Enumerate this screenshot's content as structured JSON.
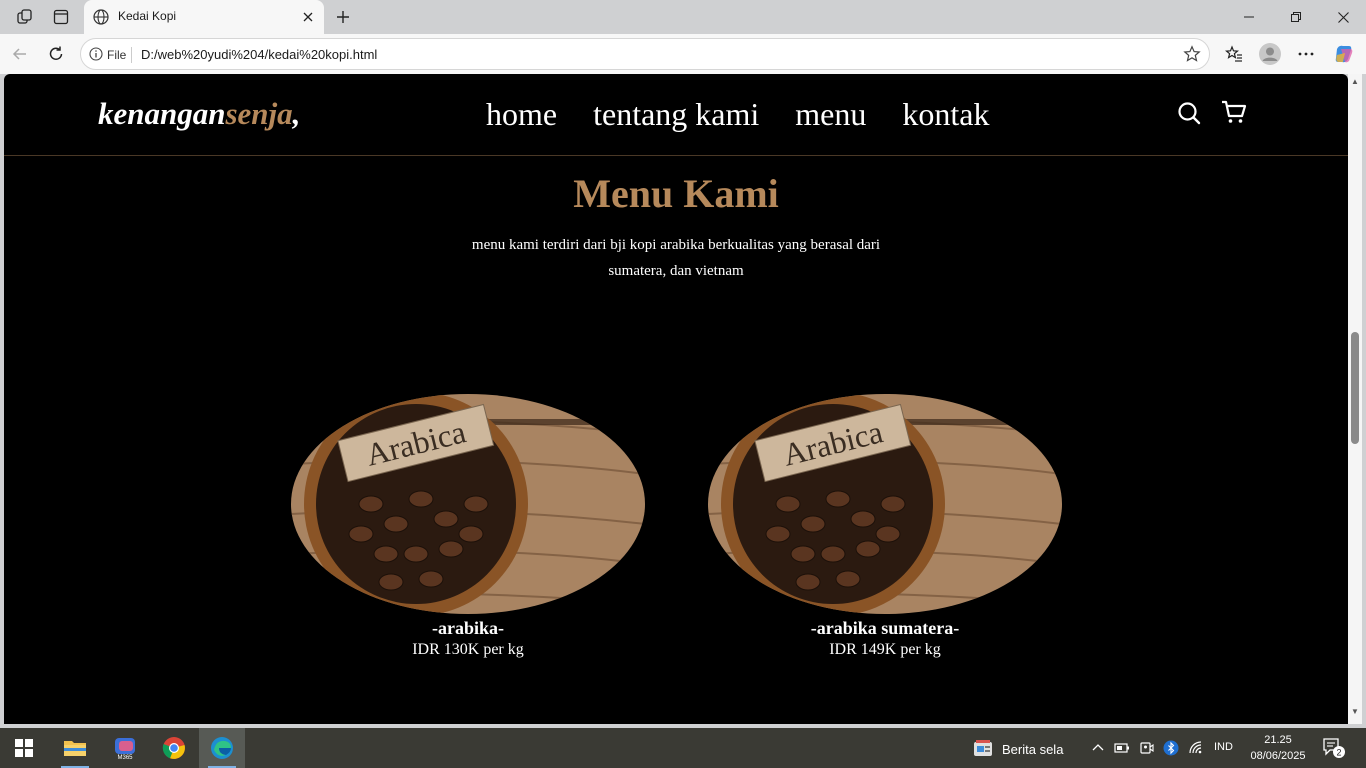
{
  "browser": {
    "tab_title": "Kedai Kopi",
    "address_info": "File",
    "url": "D:/web%20yudi%204/kedai%20kopi.html"
  },
  "site": {
    "logo_main": "kenangan",
    "logo_accent": "senja",
    "logo_suffix": ",",
    "nav": [
      "home",
      "tentang kami",
      "menu",
      "kontak"
    ],
    "section_title": "Menu Kami",
    "section_desc": "menu kami terdiri dari bji kopi arabika berkualitas yang berasal dari sumatera, dan vietnam",
    "image_label": "Arabica",
    "items": [
      {
        "name": "-arabika-",
        "price": "IDR 130K per kg"
      },
      {
        "name": "-arabika sumatera-",
        "price": "IDR 149K per kg"
      }
    ]
  },
  "taskbar": {
    "news": "Berita sela",
    "language": "IND",
    "time": "21.25",
    "date": "08/06/2025",
    "notification_count": "2"
  },
  "colors": {
    "accent": "#b6895b",
    "page_bg": "#000000"
  }
}
